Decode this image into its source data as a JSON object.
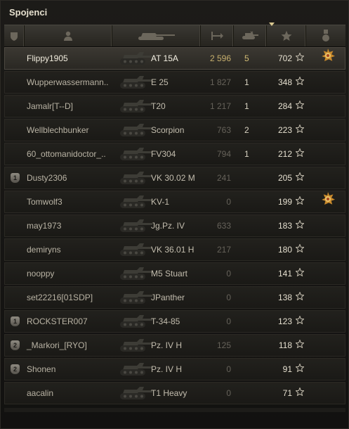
{
  "panel": {
    "title": "Spojenci"
  },
  "header": {
    "columns": [
      {
        "name": "platoon-column",
        "icon": "shield-icon"
      },
      {
        "name": "player-column",
        "icon": "person-icon"
      },
      {
        "name": "tank-column",
        "icon": "tank-icon"
      },
      {
        "name": "damage-column",
        "icon": "damage-icon"
      },
      {
        "name": "kills-column",
        "icon": "destroyed-tanks-icon"
      },
      {
        "name": "xp-column",
        "icon": "star-icon",
        "sorted": true
      },
      {
        "name": "medal-column",
        "icon": "medal-icon"
      }
    ]
  },
  "rows": [
    {
      "player": "Flippy1905",
      "tank": "AT 15A",
      "damage": "2 596",
      "kills": "5",
      "xp": "702",
      "platoon": "",
      "medal": true,
      "self": true
    },
    {
      "player": "Wupperwassermann..",
      "tank": "E 25",
      "damage": "1 827",
      "kills": "1",
      "xp": "348",
      "platoon": "",
      "medal": false
    },
    {
      "player": "Jamalr[T--D]",
      "tank": "T20",
      "damage": "1 217",
      "kills": "1",
      "xp": "284",
      "platoon": "",
      "medal": false
    },
    {
      "player": "Wellblechbunker",
      "tank": "Scorpion",
      "damage": "763",
      "kills": "2",
      "xp": "223",
      "platoon": "",
      "medal": false
    },
    {
      "player": "60_ottomanidoctor_..",
      "tank": "FV304",
      "damage": "794",
      "kills": "1",
      "xp": "212",
      "platoon": "",
      "medal": false
    },
    {
      "player": "Dusty2306",
      "tank": "VK 30.02 M",
      "damage": "241",
      "kills": "",
      "xp": "205",
      "platoon": "1",
      "medal": false
    },
    {
      "player": "Tomwolf3",
      "tank": "KV-1",
      "damage": "0",
      "kills": "",
      "xp": "199",
      "platoon": "",
      "medal": true
    },
    {
      "player": "may1973",
      "tank": "Jg.Pz. IV",
      "damage": "633",
      "kills": "",
      "xp": "183",
      "platoon": "",
      "medal": false
    },
    {
      "player": "demiryns",
      "tank": "VK 36.01 H",
      "damage": "217",
      "kills": "",
      "xp": "180",
      "platoon": "",
      "medal": false
    },
    {
      "player": "nooppy",
      "tank": "M5 Stuart",
      "damage": "0",
      "kills": "",
      "xp": "141",
      "platoon": "",
      "medal": false
    },
    {
      "player": "set22216[01SDP]",
      "tank": "JPanther",
      "damage": "0",
      "kills": "",
      "xp": "138",
      "platoon": "",
      "medal": false
    },
    {
      "player": "ROCKSTER007",
      "tank": "T-34-85",
      "damage": "0",
      "kills": "",
      "xp": "123",
      "platoon": "1",
      "medal": false
    },
    {
      "player": "_Markori_[RYO]",
      "tank": "Pz. IV H",
      "damage": "125",
      "kills": "",
      "xp": "118",
      "platoon": "2",
      "medal": false
    },
    {
      "player": "Shonen",
      "tank": "Pz. IV H",
      "damage": "0",
      "kills": "",
      "xp": "91",
      "platoon": "2",
      "medal": false
    },
    {
      "player": "aacalin",
      "tank": "T1 Heavy",
      "damage": "0",
      "kills": "",
      "xp": "71",
      "platoon": "",
      "medal": false
    }
  ],
  "colors": {
    "self_highlight": "#3b3832",
    "damage_self": "#c7b06e",
    "accent_gold": "#d9c890"
  }
}
